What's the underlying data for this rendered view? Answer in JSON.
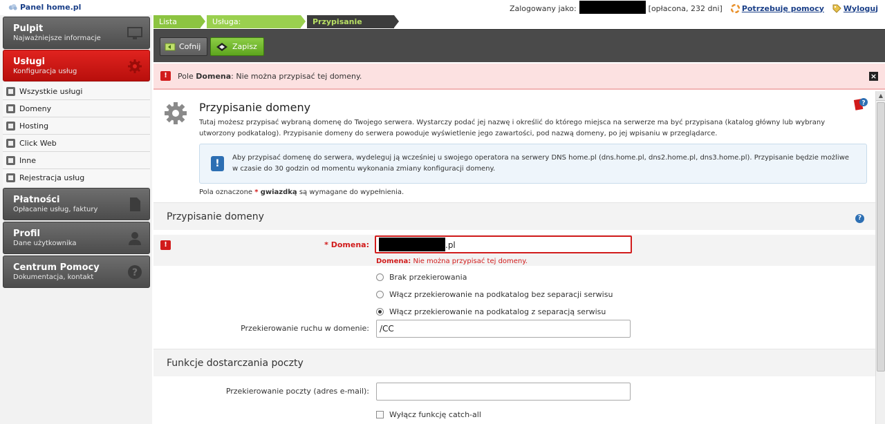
{
  "header": {
    "logo_prefix": "Panel",
    "logo_brand": "home.pl",
    "logged_in_label": "Zalogowany jako:",
    "account_status": "[opłacona, 232 dni]",
    "help_label": "Potrzebuję pomocy",
    "logout_label": "Wyloguj"
  },
  "sidebar": {
    "pulpit": {
      "title": "Pulpit",
      "subtitle": "Najważniejsze informacje"
    },
    "uslugi": {
      "title": "Usługi",
      "subtitle": "Konfiguracja usług"
    },
    "items": [
      {
        "label": "Wszystkie usługi"
      },
      {
        "label": "Domeny"
      },
      {
        "label": "Hosting"
      },
      {
        "label": "Click Web"
      },
      {
        "label": "Inne"
      },
      {
        "label": "Rejestracja usług"
      }
    ],
    "platnosci": {
      "title": "Płatności",
      "subtitle": "Opłacanie usług, faktury"
    },
    "profil": {
      "title": "Profil",
      "subtitle": "Dane użytkownika"
    },
    "pomoc": {
      "title": "Centrum Pomocy",
      "subtitle": "Dokumentacja, kontakt"
    }
  },
  "breadcrumbs": [
    {
      "label": "Lista usług"
    },
    {
      "label": "Usługa:"
    },
    {
      "label": "Przypisanie domeny"
    }
  ],
  "toolbar": {
    "back_label": "Cofnij",
    "save_label": "Zapisz"
  },
  "error_bar": {
    "prefix": "Pole",
    "field": "Domena",
    "message": ": Nie można przypisać tej domeny."
  },
  "intro": {
    "title": "Przypisanie domeny",
    "text": "Tutaj możesz przypisać wybraną domenę do Twojego serwera. Wystarczy podać jej nazwę i określić do którego miejsca na serwerze ma być przypisana (katalog główny lub wybrany utworzony podkatalog). Przypisanie domeny do serwera powoduje wyświetlenie jego zawartości, pod nazwą domeny, po jej wpisaniu w przeglądarce.",
    "info": "Aby przypisać domenę do serwera, wydeleguj ją wcześniej u swojego operatora na serwery DNS home.pl (dns.home.pl, dns2.home.pl, dns3.home.pl). Przypisanie będzie możliwe w czasie do 30 godzin od momentu wykonania zmiany konfiguracji domeny.",
    "required_prefix": "Pola oznaczone",
    "required_star": "*",
    "required_word": "gwiazdką",
    "required_suffix": "są wymagane do wypełnienia."
  },
  "section1": {
    "title": "Przypisanie domeny",
    "domain_label": "* Domena:",
    "domain_suffix": ".pl",
    "domain_error_field": "Domena:",
    "domain_error_msg": "Nie można przypisać tej domeny.",
    "radios": [
      {
        "label": "Brak przekierowania",
        "selected": false
      },
      {
        "label": "Włącz przekierowanie na podkatalog bez separacji serwisu",
        "selected": false
      },
      {
        "label": "Włącz przekierowanie na podkatalog z separacją serwisu",
        "selected": true
      }
    ],
    "redirect_label": "Przekierowanie ruchu w domenie:",
    "redirect_value": "/CC"
  },
  "section2": {
    "title": "Funkcje dostarczania poczty",
    "mail_label": "Przekierowanie poczty (adres e-mail):",
    "mail_value": "",
    "catchall_label": "Wyłącz funkcję catch-all"
  },
  "colors": {
    "accent_red": "#d11b1b",
    "accent_green": "#8cc441",
    "link_blue": "#1a3f88"
  }
}
